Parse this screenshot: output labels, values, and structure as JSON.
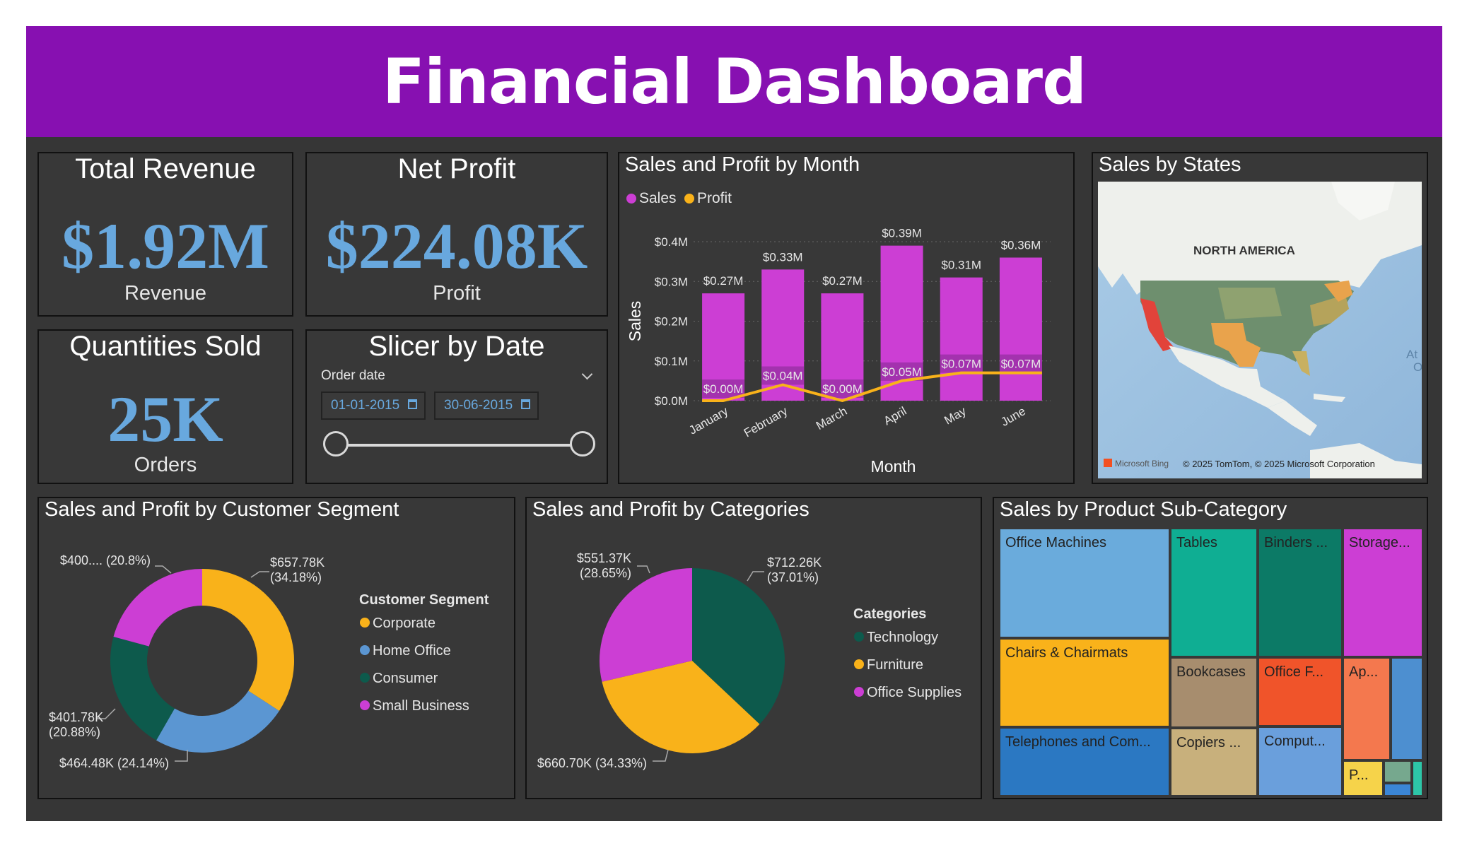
{
  "title": "Financial Dashboard",
  "kpis": {
    "revenue": {
      "title": "Total Revenue",
      "value": "$1.92M",
      "label": "Revenue"
    },
    "profit": {
      "title": "Net Profit",
      "value": "$224.08K",
      "label": "Profit"
    },
    "quantity": {
      "title": "Quantities Sold",
      "value": "25K",
      "label": "Orders"
    }
  },
  "slicer": {
    "title": "Slicer by Date",
    "field_label": "Order date",
    "start": "01-01-2015",
    "end": "30-06-2015",
    "start_fraction": 0,
    "end_fraction": 1
  },
  "map": {
    "title": "Sales by States",
    "continent_label": "NORTH AMERICA",
    "edge_label_1": "At",
    "edge_label_2": "O",
    "attribution_brand": "Microsoft Bing",
    "attribution": "© 2025 TomTom, © 2025 Microsoft Corporation"
  },
  "colors": {
    "banner": "#8710b1",
    "kpi_value": "#68a8de",
    "sales": "#cc3ed4",
    "profit": "#f9b21a",
    "corporate": "#f9b21a",
    "home_office": "#5b96d2",
    "consumer": "#0d5a4c",
    "small_business": "#cc3ed4",
    "technology": "#0d5a4c",
    "furniture": "#f9b21a",
    "office_supplies": "#cc3ed4"
  },
  "chart_data": [
    {
      "id": "sales_profit_month",
      "type": "bar",
      "title": "Sales and Profit by Month",
      "xlabel": "Month",
      "ylabel": "Sales",
      "ylim": [
        0,
        0.4
      ],
      "y_ticks": [
        "$0.0M",
        "$0.1M",
        "$0.2M",
        "$0.3M",
        "$0.4M"
      ],
      "legend": {
        "position": "top-left",
        "entries": [
          "Sales",
          "Profit"
        ]
      },
      "categories": [
        "January",
        "February",
        "March",
        "April",
        "May",
        "June"
      ],
      "series": [
        {
          "name": "Sales",
          "type": "bar",
          "values": [
            0.27,
            0.33,
            0.27,
            0.39,
            0.31,
            0.36
          ],
          "labels": [
            "$0.27M",
            "$0.33M",
            "$0.27M",
            "$0.39M",
            "$0.31M",
            "$0.36M"
          ]
        },
        {
          "name": "Profit",
          "type": "line",
          "values": [
            0.0,
            0.04,
            0.0,
            0.05,
            0.07,
            0.07
          ],
          "labels": [
            "$0.00M",
            "$0.04M",
            "$0.00M",
            "$0.05M",
            "$0.07M",
            "$0.07M"
          ]
        }
      ]
    },
    {
      "id": "customer_segment",
      "type": "pie",
      "donut": true,
      "title": "Sales and Profit by Customer Segment",
      "legend_title": "Customer Segment",
      "legend_entries": [
        "Corporate",
        "Home Office",
        "Consumer",
        "Small Business"
      ],
      "slices": [
        {
          "name": "Corporate",
          "value": 657.78,
          "pct": 34.18,
          "label_a": "$657.78K",
          "label_b": "(34.18%)"
        },
        {
          "name": "Home Office",
          "value": 464.48,
          "pct": 24.14,
          "label_a": "$464.48K (24.14%)",
          "label_b": ""
        },
        {
          "name": "Consumer",
          "value": 401.78,
          "pct": 20.88,
          "label_a": "$401.78K",
          "label_b": "(20.88%)"
        },
        {
          "name": "Small Business",
          "value": 400.0,
          "pct": 20.8,
          "label_a": "$400.... (20.8%)",
          "label_b": ""
        }
      ]
    },
    {
      "id": "categories",
      "type": "pie",
      "title": "Sales and Profit by Categories",
      "legend_title": "Categories",
      "legend_entries": [
        "Technology",
        "Furniture",
        "Office Supplies"
      ],
      "slices": [
        {
          "name": "Technology",
          "value": 712.26,
          "pct": 37.01,
          "label_a": "$712.26K",
          "label_b": "(37.01%)"
        },
        {
          "name": "Furniture",
          "value": 660.7,
          "pct": 34.33,
          "label_a": "$660.70K (34.33%)",
          "label_b": ""
        },
        {
          "name": "Office Supplies",
          "value": 551.37,
          "pct": 28.65,
          "label_a": "$551.37K",
          "label_b": "(28.65%)"
        }
      ]
    }
  ],
  "treemap": {
    "title": "Sales by Product Sub-Category",
    "cells": [
      {
        "label": "Office Machines",
        "color": "#6aabdc"
      },
      {
        "label": "Chairs & Chairmats",
        "color": "#f9b21a"
      },
      {
        "label": "Telephones and Com...",
        "color": "#2b78c2"
      },
      {
        "label": "Tables",
        "color": "#0fae93"
      },
      {
        "label": "Bookcases",
        "color": "#a78d6e"
      },
      {
        "label": "Copiers ...",
        "color": "#c8b07c"
      },
      {
        "label": "Binders ...",
        "color": "#0c7a66"
      },
      {
        "label": "Office F...",
        "color": "#f0542a"
      },
      {
        "label": "Comput...",
        "color": "#6a9fdc"
      },
      {
        "label": "Storage...",
        "color": "#cc3ed4"
      },
      {
        "label": "Ap...",
        "color": "#f4784e"
      },
      {
        "label": "",
        "color": "#4d8fd0"
      },
      {
        "label": "P...",
        "color": "#f6d34a"
      },
      {
        "label": "",
        "color": "#76a88e"
      },
      {
        "label": "",
        "color": "#3b86d6"
      },
      {
        "label": "",
        "color": "#2dc6a8"
      }
    ]
  }
}
